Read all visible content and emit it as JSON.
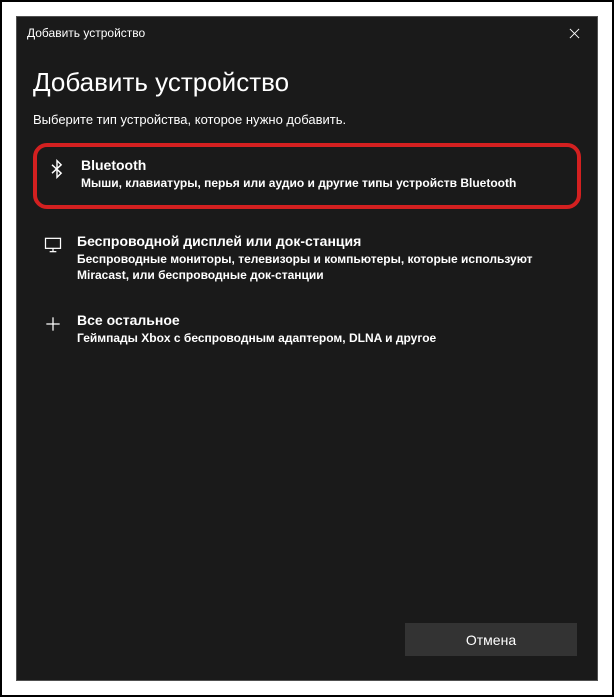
{
  "titlebar": {
    "title": "Добавить устройство"
  },
  "main": {
    "heading": "Добавить устройство",
    "subheading": "Выберите тип устройства, которое нужно добавить."
  },
  "options": {
    "bluetooth": {
      "title": "Bluetooth",
      "desc": "Мыши, клавиатуры, перья или аудио и другие типы устройств Bluetooth"
    },
    "wireless": {
      "title": "Беспроводной дисплей или док-станция",
      "desc": "Беспроводные мониторы, телевизоры и компьютеры, которые используют Miracast, или беспроводные док-станции"
    },
    "other": {
      "title": "Все остальное",
      "desc": "Геймпады Xbox с беспроводным адаптером, DLNA и другое"
    }
  },
  "footer": {
    "cancel": "Отмена"
  }
}
